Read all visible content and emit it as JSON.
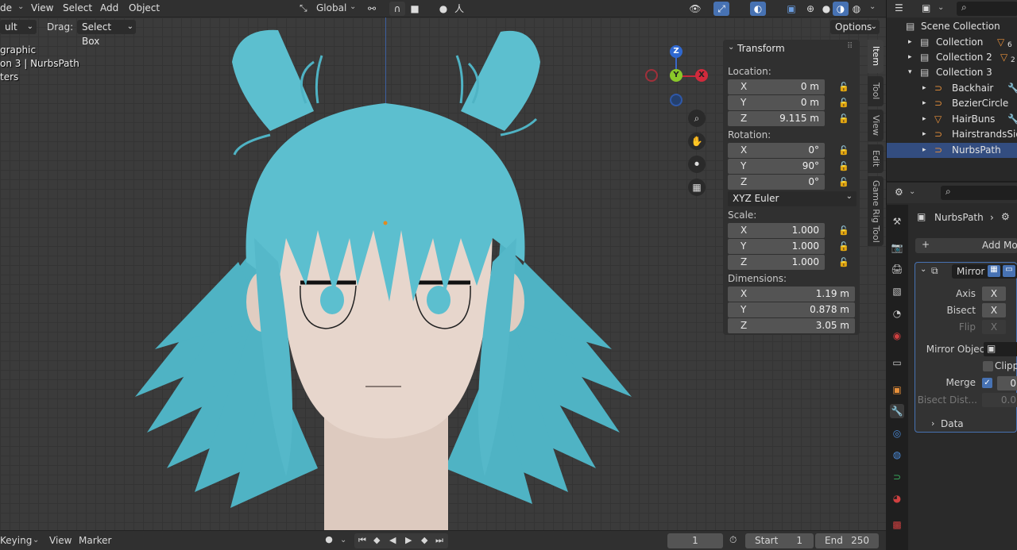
{
  "header": {
    "mode_label": "de",
    "menus": [
      "View",
      "Select",
      "Add",
      "Object"
    ],
    "transform_orientation": "Global"
  },
  "header2": {
    "pivot_label": "ult",
    "drag_label": "Drag:",
    "drag_value": "Select Box",
    "options_label": "Options"
  },
  "overlay_text": [
    "graphic",
    "on 3 | NurbsPath",
    "ters"
  ],
  "gizmo": {
    "z": "Z",
    "y": "Y",
    "x": "X"
  },
  "npanel": {
    "title": "Transform",
    "location_label": "Location:",
    "location": [
      {
        "axis": "X",
        "value": "0 m"
      },
      {
        "axis": "Y",
        "value": "0 m"
      },
      {
        "axis": "Z",
        "value": "9.115 m"
      }
    ],
    "rotation_label": "Rotation:",
    "rotation": [
      {
        "axis": "X",
        "value": "0°"
      },
      {
        "axis": "Y",
        "value": "90°"
      },
      {
        "axis": "Z",
        "value": "0°"
      }
    ],
    "rotation_mode": "XYZ Euler",
    "scale_label": "Scale:",
    "scale": [
      {
        "axis": "X",
        "value": "1.000"
      },
      {
        "axis": "Y",
        "value": "1.000"
      },
      {
        "axis": "Z",
        "value": "1.000"
      }
    ],
    "dimensions_label": "Dimensions:",
    "dimensions": [
      {
        "axis": "X",
        "value": "1.19 m"
      },
      {
        "axis": "Y",
        "value": "0.878 m"
      },
      {
        "axis": "Z",
        "value": "3.05 m"
      }
    ]
  },
  "vtabs": [
    "Item",
    "Tool",
    "View",
    "Edit",
    "Game Rig Tool"
  ],
  "timeline": {
    "menus": [
      "Keying",
      "View",
      "Marker"
    ],
    "current_frame": "1",
    "start_label": "Start",
    "start": "1",
    "end_label": "End",
    "end": "250"
  },
  "outliner": {
    "root": "Scene Collection",
    "items": [
      {
        "name": "Collection",
        "badge": "6"
      },
      {
        "name": "Collection 2",
        "badge": "2"
      },
      {
        "name": "Collection 3",
        "badge": ""
      },
      {
        "name": "Backhair",
        "badge": ""
      },
      {
        "name": "BezierCircle",
        "badge": ""
      },
      {
        "name": "HairBuns",
        "badge": ""
      },
      {
        "name": "HairstrandsSides",
        "badge": ""
      },
      {
        "name": "NurbsPath",
        "badge": ""
      }
    ]
  },
  "properties": {
    "object_name": "NurbsPath",
    "add_modifier": "Add Mod",
    "modifier_name": "Mirror",
    "axis_label": "Axis",
    "axis_value": "X",
    "bisect_label": "Bisect",
    "bisect_value": "X",
    "flip_label": "Flip",
    "flip_value": "X",
    "mirror_object_label": "Mirror Object",
    "clipping_label": "Clippi",
    "merge_label": "Merge",
    "merge_value": "0",
    "bisect_dist_label": "Bisect Dist...",
    "bisect_dist_value": "0.0",
    "data_label": "Data"
  },
  "colors": {
    "hair": "#5cbfcf",
    "skin": "#e7d6cc",
    "accent": "#4772b3",
    "grid_bg": "#3b3b3b"
  }
}
